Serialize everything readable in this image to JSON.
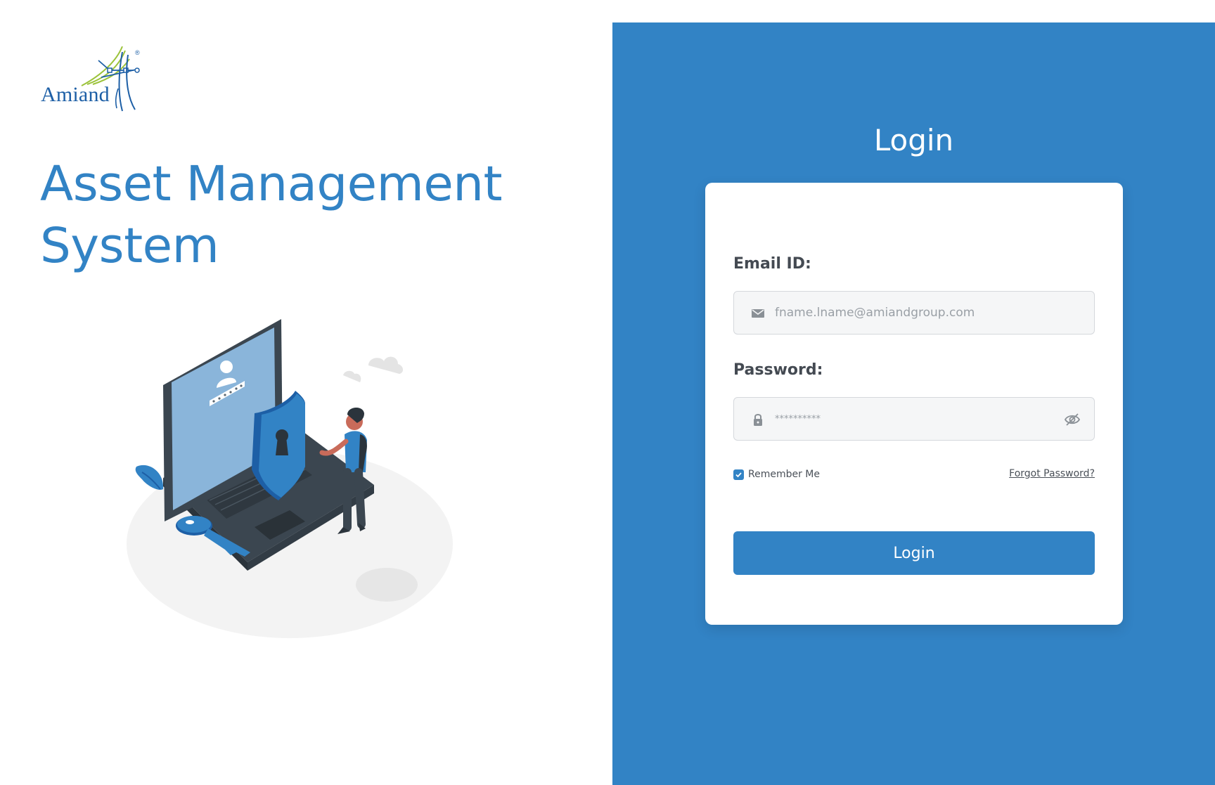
{
  "brand": {
    "logo_text": "Amiand",
    "registered_mark": "®",
    "primary_color": "#3283c5"
  },
  "app": {
    "title_line1": "Asset Management",
    "title_line2": "System"
  },
  "login": {
    "heading": "Login",
    "email_label": "Email ID:",
    "email_placeholder": "fname.lname@amiandgroup.com",
    "password_label": "Password:",
    "password_value": "**********",
    "remember_label": "Remember Me",
    "remember_checked": true,
    "forgot_label": "Forgot Password?",
    "button_label": "Login"
  },
  "icons": {
    "email": "mail-icon",
    "password": "lock-icon",
    "toggle": "eye-slash-icon",
    "checkbox": "check-icon"
  }
}
